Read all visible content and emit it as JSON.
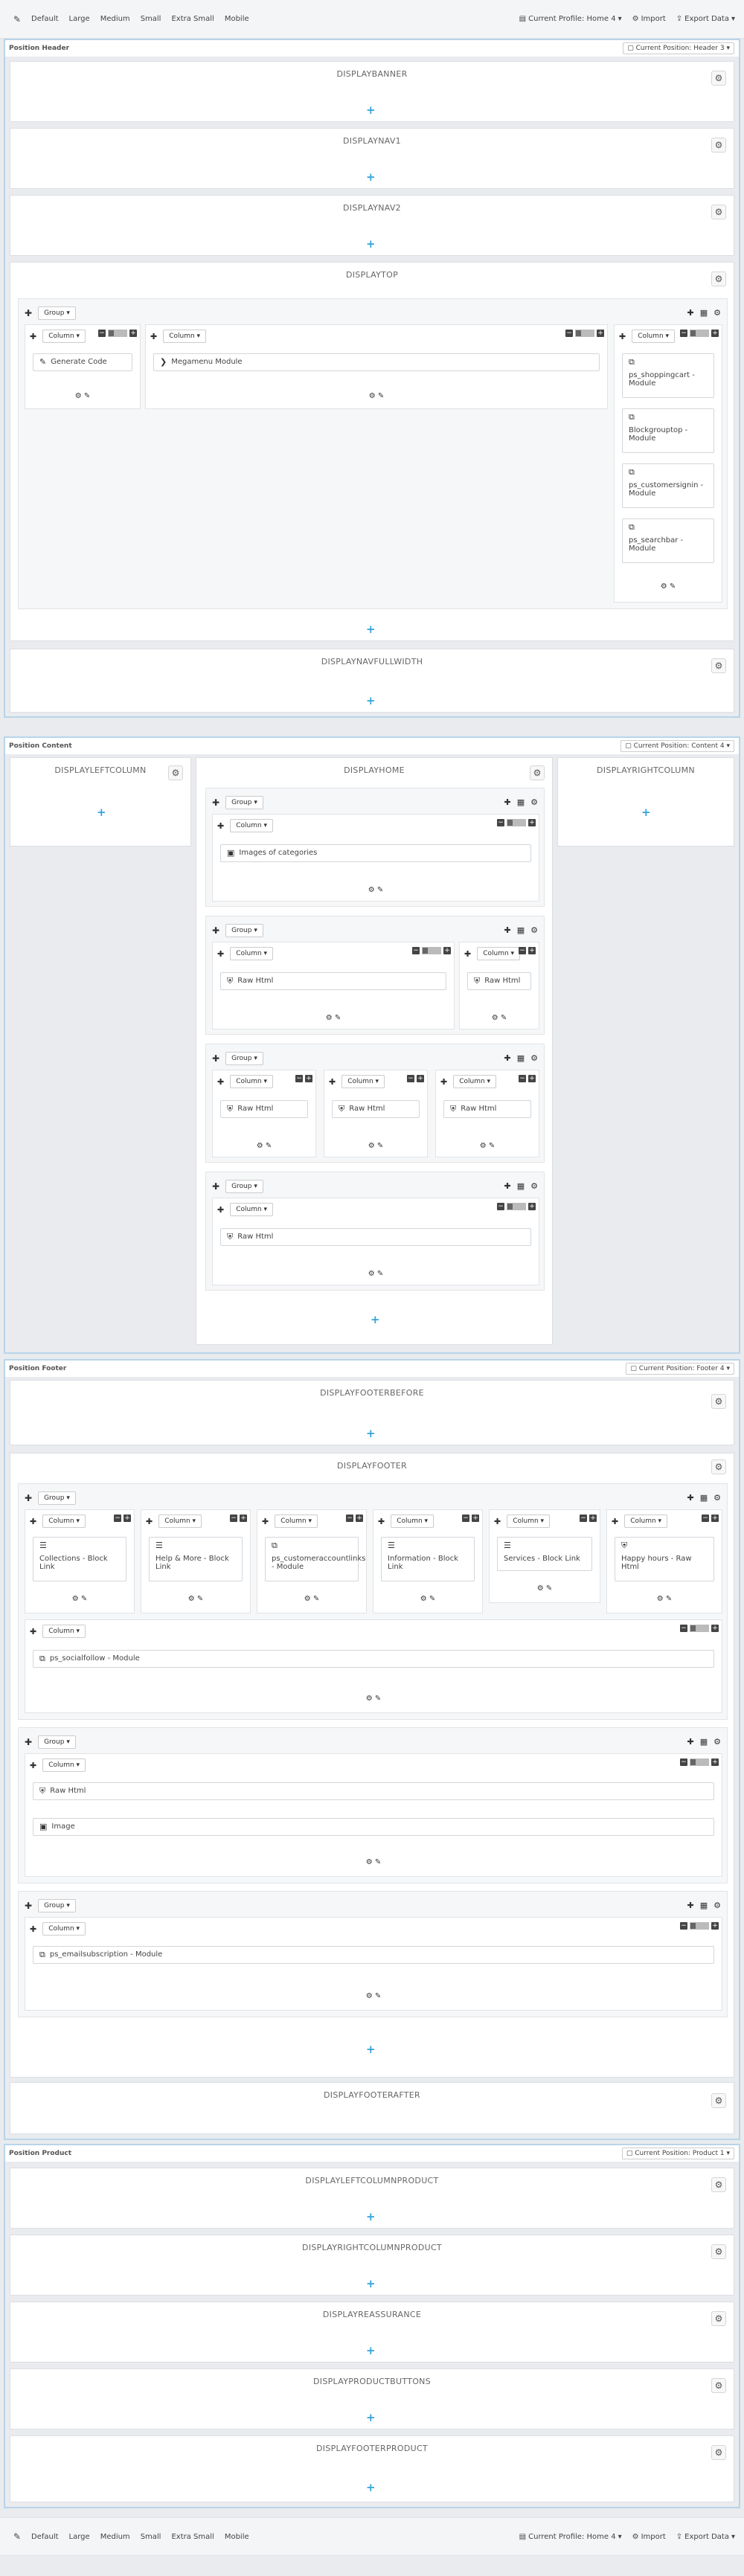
{
  "toolbar": {
    "sizes": [
      "Default",
      "Large",
      "Medium",
      "Small",
      "Extra Small",
      "Mobile"
    ],
    "current_profile": "Current Profile: Home 4",
    "import": "Import",
    "export": "Export Data"
  },
  "sections": {
    "header": {
      "title": "Position Header",
      "position": "Current Position: Header 3"
    },
    "content": {
      "title": "Position Content",
      "position": "Current Position: Content 4"
    },
    "footer": {
      "title": "Position Footer",
      "position": "Current Position: Footer 4"
    },
    "product": {
      "title": "Position Product",
      "position": "Current Position: Product 1"
    }
  },
  "labels": {
    "group": "Group",
    "column": "Column"
  },
  "hooks": {
    "banner": "DISPLAYBANNER",
    "nav1": "DISPLAYNAV1",
    "nav2": "DISPLAYNAV2",
    "top": "DISPLAYTOP",
    "navfull": "DISPLAYNAVFULLWIDTH",
    "leftcol": "DISPLAYLEFTCOLUMN",
    "home": "DISPLAYHOME",
    "rightcol": "DISPLAYRIGHTCOLUMN",
    "footerbefore": "DISPLAYFOOTERBEFORE",
    "footer": "DISPLAYFOOTER",
    "footerafter": "DISPLAYFOOTERAFTER",
    "leftcolproduct": "DISPLAYLEFTCOLUMNPRODUCT",
    "rightcolproduct": "DISPLAYRIGHTCOLUMNPRODUCT",
    "reassurance": "DISPLAYREASSURANCE",
    "productbuttons": "DISPLAYPRODUCTBUTTONS",
    "footerproduct": "DISPLAYFOOTERPRODUCT"
  },
  "modules": {
    "generate_code": "Generate Code",
    "megamenu": "Megamenu Module",
    "shoppingcart": "ps_shoppingcart - Module",
    "blockgrouptop": "Blockgrouptop - Module",
    "customersignin": "ps_customersignin - Module",
    "searchbar": "ps_searchbar - Module",
    "images_categories": "Images of categories",
    "raw_html": "Raw Html",
    "collections": "Collections - Block Link",
    "help_more": "Help & More - Block Link",
    "customeraccountlinks": "ps_customeraccountlinks - Module",
    "information": "Information - Block Link",
    "services": "Services - Block Link",
    "happy_hours": "Happy hours - Raw Html",
    "socialfollow": "ps_socialfollow - Module",
    "image": "Image",
    "emailsubscription": "ps_emailsubscription - Module"
  }
}
